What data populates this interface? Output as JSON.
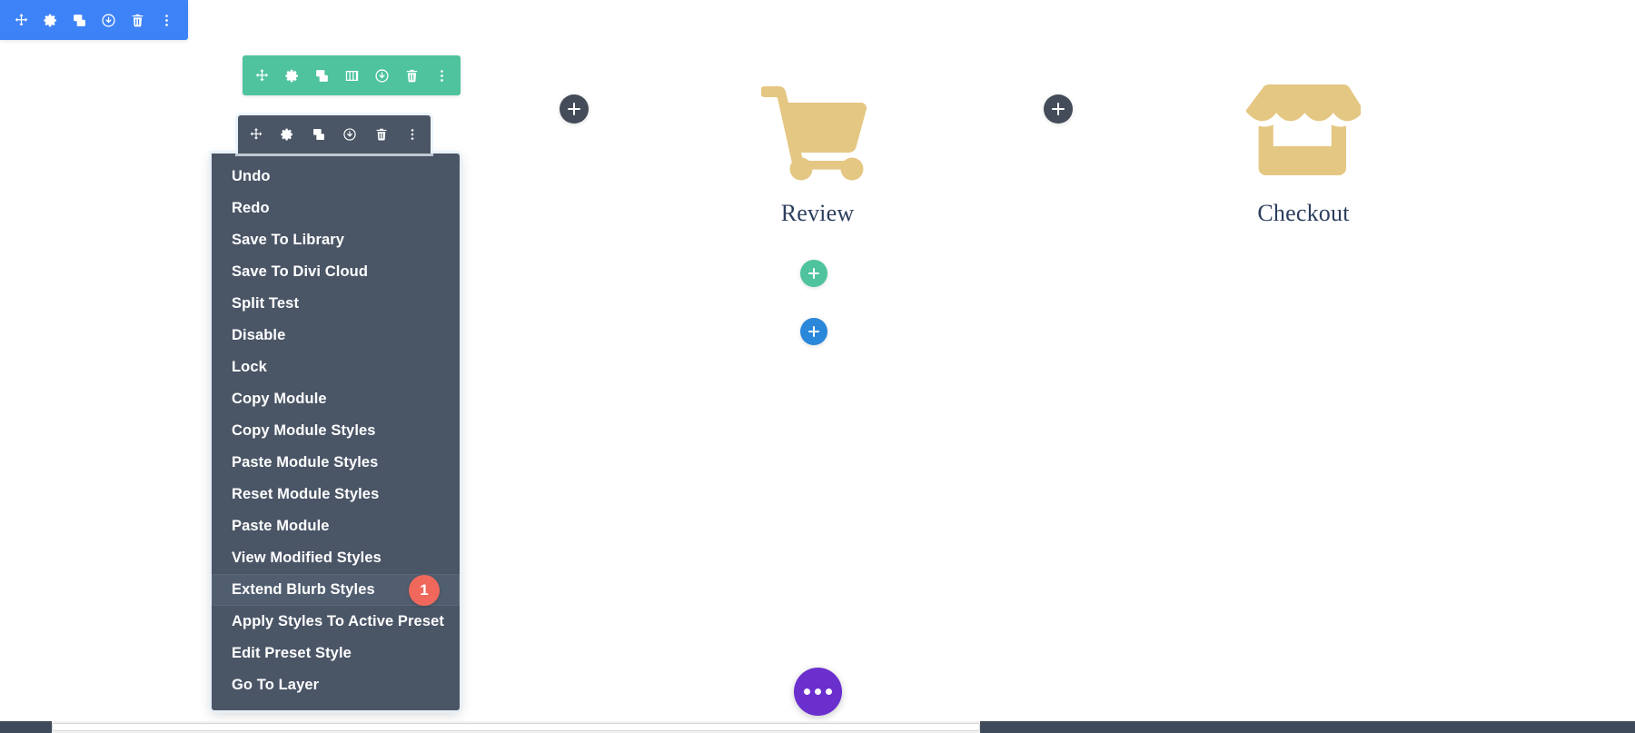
{
  "page_toolbar": {
    "name": "page-settings-bar",
    "buttons": [
      {
        "icon": "move-icon",
        "label": "Move"
      },
      {
        "icon": "gear-icon",
        "label": "Settings"
      },
      {
        "icon": "duplicate-icon",
        "label": "Duplicate"
      },
      {
        "icon": "power-icon",
        "label": "Disable"
      },
      {
        "icon": "trash-icon",
        "label": "Delete"
      },
      {
        "icon": "kebab-icon",
        "label": "More Options"
      }
    ],
    "color": "#3E82F7"
  },
  "row_toolbar": {
    "name": "row-settings-bar",
    "buttons": [
      {
        "icon": "move-icon",
        "label": "Move Row"
      },
      {
        "icon": "gear-icon",
        "label": "Row Settings"
      },
      {
        "icon": "duplicate-icon",
        "label": "Duplicate Row"
      },
      {
        "icon": "columns-icon",
        "label": "Change Column Structure"
      },
      {
        "icon": "power-icon",
        "label": "Disable Row"
      },
      {
        "icon": "trash-icon",
        "label": "Delete Row"
      },
      {
        "icon": "kebab-icon",
        "label": "Row Options"
      }
    ],
    "color": "#4EC39E"
  },
  "module_toolbar": {
    "name": "module-settings-bar",
    "buttons": [
      {
        "icon": "move-icon",
        "label": "Move Module"
      },
      {
        "icon": "gear-icon",
        "label": "Module Settings"
      },
      {
        "icon": "duplicate-icon",
        "label": "Duplicate Module"
      },
      {
        "icon": "power-icon",
        "label": "Disable Module"
      },
      {
        "icon": "trash-icon",
        "label": "Delete Module"
      },
      {
        "icon": "kebab-icon",
        "label": "Module Options"
      }
    ],
    "color": "#4A5566"
  },
  "context_menu": {
    "highlighted_index": 13,
    "badge": "1",
    "badge_color": "#F0685B",
    "background": "#4A5566",
    "items": [
      {
        "label": "Undo"
      },
      {
        "label": "Redo"
      },
      {
        "label": "Save To Library"
      },
      {
        "label": "Save To Divi Cloud"
      },
      {
        "label": "Split Test"
      },
      {
        "label": "Disable"
      },
      {
        "label": "Lock"
      },
      {
        "label": "Copy Module"
      },
      {
        "label": "Copy Module Styles"
      },
      {
        "label": "Paste Module Styles"
      },
      {
        "label": "Reset Module Styles"
      },
      {
        "label": "Paste Module"
      },
      {
        "label": "View Modified Styles"
      },
      {
        "label": "Extend Blurb Styles"
      },
      {
        "label": "Apply Styles To Active Preset"
      },
      {
        "label": "Edit Preset Style"
      },
      {
        "label": "Go To Layer"
      }
    ]
  },
  "content": {
    "blurbs": [
      {
        "icon": "shopping-cart-icon",
        "title": "Review",
        "icon_color": "#E4C782"
      },
      {
        "icon": "shop-store-icon",
        "title": "Checkout",
        "icon_color": "#E4C782"
      }
    ],
    "title_color": "#2C3E5C"
  },
  "add_buttons": {
    "add_section_left": {
      "icon": "plus-icon",
      "label": "Add New Section",
      "color": "#444C59"
    },
    "add_section_right": {
      "icon": "plus-icon",
      "label": "Add New Section",
      "color": "#444C59"
    },
    "add_row": {
      "icon": "plus-icon",
      "label": "Add New Row",
      "color": "#4EC39E"
    },
    "add_module": {
      "icon": "plus-icon",
      "label": "Add New Module",
      "color": "#2B87DA"
    }
  },
  "settings_fab": {
    "icon": "ellipsis-icon",
    "label": "Builder Settings",
    "color": "#6B2FCE"
  },
  "scrollbar": {
    "name": "horizontal-scrollbar",
    "orientation": "horizontal"
  }
}
